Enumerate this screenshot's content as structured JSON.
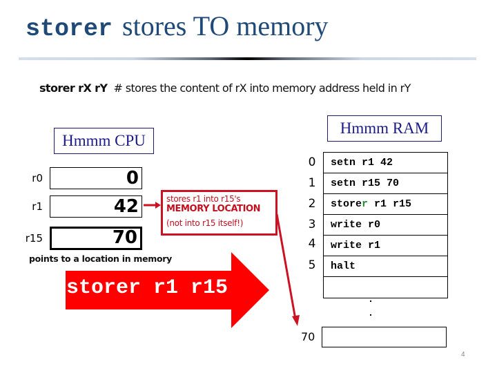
{
  "title": {
    "code": "storer",
    "text": "stores TO memory"
  },
  "syntax": {
    "command": "storer rX rY",
    "comment": "# stores the content of rX into memory address held in rY"
  },
  "cpu": {
    "label": "Hmmm CPU",
    "registers": [
      {
        "name": "r0",
        "value": "0"
      },
      {
        "name": "r1",
        "value": "42"
      },
      {
        "name": "r15",
        "value": "70"
      }
    ],
    "note": "points to a location in memory"
  },
  "callout": {
    "line1": "stores r1 into r15's",
    "line2": "MEMORY LOCATION",
    "line3": "(not into r15 itself!)"
  },
  "big_arrow": {
    "label": "storer r1 r15",
    "color": "#ff0000"
  },
  "ram": {
    "label": "Hmmm RAM",
    "rows": [
      {
        "addr": "0",
        "instr": "setn r1 42"
      },
      {
        "addr": "1",
        "instr": "setn r15 70"
      },
      {
        "addr": "2",
        "instr_prefix": "store",
        "instr_highlight": "r",
        "instr_suffix": " r1 r15"
      },
      {
        "addr": "3",
        "instr": "write r0"
      },
      {
        "addr": "4",
        "instr": "write r1"
      },
      {
        "addr": "5",
        "instr": "halt"
      },
      {
        "addr": "",
        "instr": ""
      }
    ],
    "target_addr": "70",
    "highlight_color": "#2a8a3a"
  },
  "page_number": "4"
}
